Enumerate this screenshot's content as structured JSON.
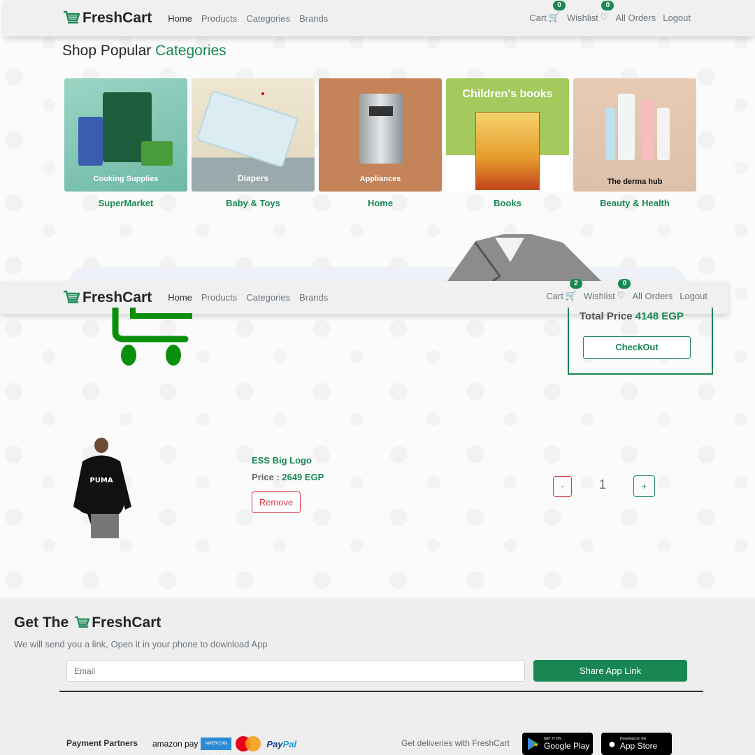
{
  "brand": {
    "name": "FreshCart",
    "color": "#198754"
  },
  "nav_top": {
    "links": [
      "Home",
      "Products",
      "Categories",
      "Brands"
    ],
    "cart_label": "Cart",
    "cart_count": "0",
    "wishlist_label": "Wishlist",
    "wishlist_count": "0",
    "orders_label": "All Orders",
    "logout_label": "Logout"
  },
  "categories_section": {
    "title_plain": "Shop Popular ",
    "title_accent": "Categories",
    "items": [
      {
        "name": "SuperMarket",
        "caption": "Cooking Supplies"
      },
      {
        "name": "Baby & Toys",
        "caption": "Diapers"
      },
      {
        "name": "Home",
        "caption": "Appliances"
      },
      {
        "name": "Books",
        "caption": "Children's books"
      },
      {
        "name": "Beauty & Health",
        "caption": "The derma hub"
      }
    ]
  },
  "nav_second": {
    "links": [
      "Home",
      "Products",
      "Categories",
      "Brands"
    ],
    "cart_label": "Cart",
    "cart_count": "2",
    "wishlist_label": "Wishlist",
    "wishlist_count": "0",
    "orders_label": "All Orders",
    "logout_label": "Logout"
  },
  "cart": {
    "total_label": "Total Price",
    "total_value": "4148 EGP",
    "checkout_label": "CheckOut",
    "item": {
      "title": "ESS Big Logo",
      "price_label": "Price : ",
      "price_value": "2649 EGP",
      "remove_label": "Remove",
      "minus_label": "-",
      "quantity": "1",
      "plus_label": "+",
      "shirt_text": "PUMA"
    }
  },
  "footer": {
    "title_prefix": "Get The",
    "brand": "FreshCart",
    "subtitle": "We will send you a link, Open it in your phone to download App",
    "email_placeholder": "Email",
    "share_label": "Share App Link",
    "payment_label": "Payment Partners",
    "payment_logos": {
      "amazon": "amazon",
      "amazon_suffix": "pay",
      "amex": "AMERICAN EXPRESS",
      "paypal_a": "Pay",
      "paypal_b": "Pal"
    },
    "deliveries_label": "Get deliveries with FreshCart",
    "google_small": "GET IT ON",
    "google_big": "Google Play",
    "apple_small": "Download on the",
    "apple_big": "App Store"
  }
}
